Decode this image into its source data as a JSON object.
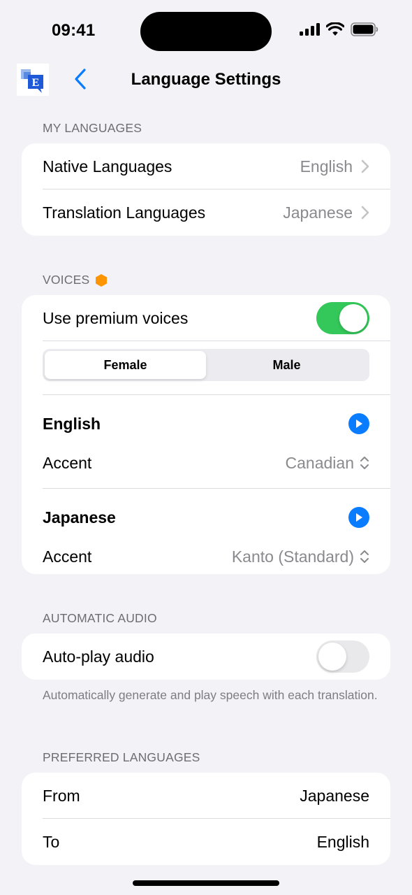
{
  "status_bar": {
    "time": "09:41"
  },
  "nav": {
    "title": "Language Settings",
    "back_icon": "chevron-left-icon",
    "logo_letter": "E"
  },
  "my_languages": {
    "header": "MY LANGUAGES",
    "rows": [
      {
        "label": "Native Languages",
        "value": "English"
      },
      {
        "label": "Translation Languages",
        "value": "Japanese"
      }
    ]
  },
  "voices": {
    "header": "VOICES",
    "premium_badge_color": "#ff9500",
    "premium_label": "Use premium voices",
    "premium_enabled": true,
    "gender_options": [
      "Female",
      "Male"
    ],
    "selected_gender": "Female",
    "languages": [
      {
        "name": "English",
        "accent_label": "Accent",
        "accent_value": "Canadian"
      },
      {
        "name": "Japanese",
        "accent_label": "Accent",
        "accent_value": "Kanto (Standard)"
      }
    ]
  },
  "automatic_audio": {
    "header": "AUTOMATIC AUDIO",
    "autoplay_label": "Auto-play audio",
    "autoplay_enabled": false,
    "note": "Automatically generate and play speech with each translation."
  },
  "preferred_languages": {
    "header": "PREFERRED LANGUAGES",
    "rows": [
      {
        "label": "From",
        "value": "Japanese"
      },
      {
        "label": "To",
        "value": "English"
      }
    ]
  },
  "colors": {
    "accent": "#0a7cff",
    "toggle_on": "#34c759",
    "background": "#f2f2f7"
  }
}
